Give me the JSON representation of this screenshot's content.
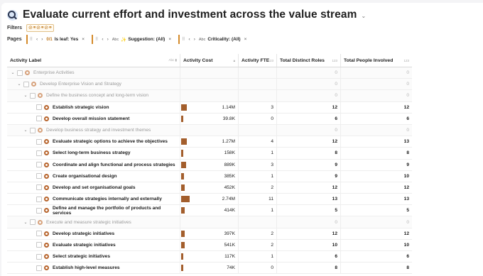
{
  "title": "Evaluate current effort and investment across the value stream",
  "filters": {
    "label": "Filters",
    "chip": "⊘⚭⊘⚭⊘⚭"
  },
  "pages": {
    "label": "Pages",
    "chips": [
      {
        "tag": "0/1",
        "name": "Is leaf: Yes"
      },
      {
        "abc": "Abc",
        "spark": "✨",
        "name": "Suggestion: (All)"
      },
      {
        "abc": "Abc",
        "name": "Criticality: (All)"
      }
    ]
  },
  "table": {
    "headers": {
      "label": "Activity Label",
      "cost": "Activity Cost",
      "fte": "Activity FTE",
      "roles": "Total Distinct Roles",
      "people": "Total People Involved",
      "abc_hint": "Abc",
      "num_hint": "123"
    },
    "max_cost_millions": 2.74,
    "rows": [
      {
        "kind": "group",
        "level": 0,
        "label": "Enterprise Activities",
        "cost": "",
        "fte": "",
        "roles": "0",
        "people": "0"
      },
      {
        "kind": "group",
        "level": 1,
        "label": "Develop Enterprise Vision and Strategy",
        "cost": "",
        "fte": "",
        "roles": "0",
        "people": "0"
      },
      {
        "kind": "group",
        "level": 2,
        "label": "Define the business concept and long-term vision",
        "cost": "",
        "fte": "",
        "roles": "0",
        "people": "0"
      },
      {
        "kind": "leaf",
        "level": 3,
        "label": "Establish strategic vision",
        "cost": "1.14M",
        "cost_m": 1.14,
        "fte": "3",
        "roles": "12",
        "people": "12"
      },
      {
        "kind": "leaf",
        "level": 3,
        "label": "Develop overall mission statement",
        "cost": "39.8K",
        "cost_m": 0.0398,
        "fte": "0",
        "roles": "6",
        "people": "6"
      },
      {
        "kind": "group",
        "level": 2,
        "label": "Develop business strategy and investment themes",
        "cost": "",
        "fte": "",
        "roles": "0",
        "people": "0"
      },
      {
        "kind": "leaf",
        "level": 3,
        "label": "Evaluate strategic options to achieve the objectives",
        "cost": "1.27M",
        "cost_m": 1.27,
        "fte": "4",
        "roles": "12",
        "people": "13"
      },
      {
        "kind": "leaf",
        "level": 3,
        "label": "Select long-term business strategy",
        "cost": "158K",
        "cost_m": 0.158,
        "fte": "1",
        "roles": "8",
        "people": "8"
      },
      {
        "kind": "leaf",
        "level": 3,
        "label": "Coordinate and align functional and process strategies",
        "cost": "889K",
        "cost_m": 0.889,
        "fte": "3",
        "roles": "9",
        "people": "9"
      },
      {
        "kind": "leaf",
        "level": 3,
        "label": "Create organisational design",
        "cost": "385K",
        "cost_m": 0.385,
        "fte": "1",
        "roles": "9",
        "people": "10"
      },
      {
        "kind": "leaf",
        "level": 3,
        "label": "Develop and set organisational goals",
        "cost": "452K",
        "cost_m": 0.452,
        "fte": "2",
        "roles": "12",
        "people": "12"
      },
      {
        "kind": "leaf",
        "level": 3,
        "label": "Communicate strategies internally and externally",
        "cost": "2.74M",
        "cost_m": 2.74,
        "fte": "11",
        "roles": "13",
        "people": "13"
      },
      {
        "kind": "leaf",
        "level": 3,
        "label": "Define and manage the portfolio of products and services",
        "cost": "414K",
        "cost_m": 0.414,
        "fte": "1",
        "roles": "5",
        "people": "5"
      },
      {
        "kind": "group",
        "level": 2,
        "label": "Execute and measure strategic initiatives",
        "cost": "",
        "fte": "",
        "roles": "0",
        "people": "0"
      },
      {
        "kind": "leaf",
        "level": 3,
        "label": "Develop strategic initiatives",
        "cost": "397K",
        "cost_m": 0.397,
        "fte": "2",
        "roles": "12",
        "people": "12"
      },
      {
        "kind": "leaf",
        "level": 3,
        "label": "Evaluate strategic initiatives",
        "cost": "541K",
        "cost_m": 0.541,
        "fte": "2",
        "roles": "10",
        "people": "10"
      },
      {
        "kind": "leaf",
        "level": 3,
        "label": "Select strategic initiatives",
        "cost": "117K",
        "cost_m": 0.117,
        "fte": "1",
        "roles": "6",
        "people": "6"
      },
      {
        "kind": "leaf",
        "level": 3,
        "label": "Establish high-level measures",
        "cost": "74K",
        "cost_m": 0.074,
        "fte": "0",
        "roles": "8",
        "people": "8"
      }
    ]
  },
  "colors": {
    "accent": "#c07a20",
    "bar": "#a35e2c",
    "dot": "#b7642c"
  }
}
